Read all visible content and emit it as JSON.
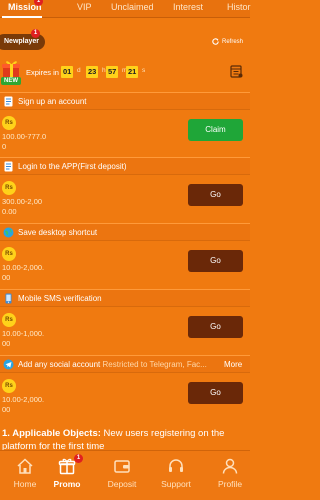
{
  "tabs": [
    {
      "label": "Mission",
      "badge": "1"
    },
    {
      "label": "VIP"
    },
    {
      "label": "Unclaimed"
    },
    {
      "label": "Interest"
    },
    {
      "label": "Histor"
    }
  ],
  "newplayer": {
    "label": "Newplayer",
    "badge": "1"
  },
  "refresh_label": "Refresh",
  "new_tag": "NEW",
  "expires": {
    "label": "Expires in",
    "days": "01",
    "d": "d",
    "hours": "23",
    "h": "h",
    "minutes": "57",
    "m": "m",
    "seconds": "21",
    "s": "s"
  },
  "currency_badge": "Rs",
  "tasks": [
    {
      "title": "Sign up an account",
      "subtitle": "",
      "amount": "100.00-777.00",
      "button": "Claim",
      "icon": "document-icon"
    },
    {
      "title": "Login to the APP(First deposit)",
      "subtitle": "",
      "amount": "300.00-2,000.00",
      "button": "Go",
      "icon": "document-icon"
    },
    {
      "title": "Save desktop shortcut",
      "subtitle": "",
      "amount": "10.00-2,000.00",
      "button": "Go",
      "icon": "globe-icon"
    },
    {
      "title": "Mobile SMS verification",
      "subtitle": "",
      "amount": "10.00-1,000.00",
      "button": "Go",
      "icon": "phone-icon"
    },
    {
      "title": "Add any social account",
      "subtitle": "Restricted to Telegram, Fac...",
      "amount": "10.00-2,000.00",
      "button": "Go",
      "icon": "social-icon"
    }
  ],
  "more_label": "More",
  "rules": {
    "heading": "1. Applicable Objects:",
    "text": "New users registering on the platform for the first time"
  },
  "bottom_nav": [
    {
      "label": "Home"
    },
    {
      "label": "Promo",
      "badge": "1"
    },
    {
      "label": "Deposit"
    },
    {
      "label": "Support"
    },
    {
      "label": "Profile"
    }
  ],
  "colors": {
    "background": "#f07a10",
    "go_button": "#6a2808",
    "claim_button": "#1fa638",
    "timer_box": "#ffd21a",
    "coin": "#ffd21a"
  }
}
